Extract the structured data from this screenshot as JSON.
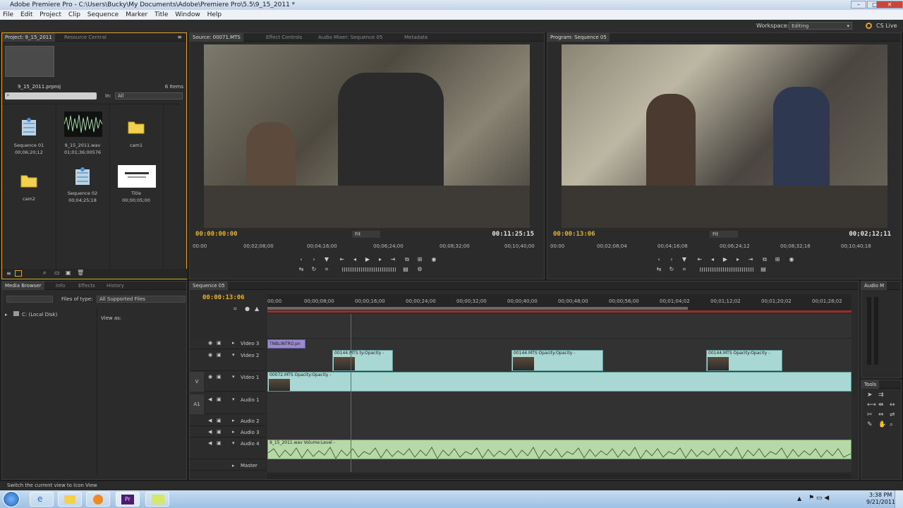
{
  "window": {
    "title": "Adobe Premiere Pro - C:\\Users\\Bucky\\My Documents\\Adobe\\Premiere Pro\\5.5\\9_15_2011 *",
    "controls": [
      "–",
      "□",
      "✕"
    ]
  },
  "menu": [
    "File",
    "Edit",
    "Project",
    "Clip",
    "Sequence",
    "Marker",
    "Title",
    "Window",
    "Help"
  ],
  "workspace": {
    "label": "Workspace:",
    "value": "Editing",
    "cs_live": "CS Live"
  },
  "project_panel": {
    "tabs": [
      "Project: 9_15_2011",
      "Resource Central"
    ],
    "file": "9_15_2011.prproj",
    "item_count": "6 Items",
    "in_label": "In:",
    "in_value": "All",
    "items": [
      {
        "name": "Sequence 01",
        "duration": "00;06;20;12",
        "type": "sequence"
      },
      {
        "name": "9_15_2011.wav",
        "duration": "01;01;36;00576",
        "type": "audio"
      },
      {
        "name": "cam1",
        "duration": "",
        "type": "folder"
      },
      {
        "name": "cam2",
        "duration": "",
        "type": "folder"
      },
      {
        "name": "Sequence 02",
        "duration": "00;04;25;18",
        "type": "sequence"
      },
      {
        "name": "Title",
        "duration": "00;00;05;00",
        "type": "title"
      }
    ]
  },
  "source_monitor": {
    "tabs": [
      "Source: 00071.MTS",
      "Effect Controls",
      "Audio Mixer: Sequence 05",
      "Metadata"
    ],
    "current_time": "00:00:00:00",
    "fit": "Fit",
    "duration": "00:11:25:15",
    "ruler": [
      "00:00",
      "00;02;08;00",
      "00;04;16;00",
      "00;06;24;00",
      "00;08;32;00",
      "00;10;40;00"
    ]
  },
  "program_monitor": {
    "tabs": [
      "Program: Sequence 05"
    ],
    "current_time": "00:00:13:06",
    "fit": "Fit",
    "duration": "00;02;12;11",
    "ruler": [
      "00:00",
      "00;02;08;04",
      "00;04;16;08",
      "00;06;24;12",
      "00;08;32;16",
      "00;10;40;18"
    ]
  },
  "media_browser": {
    "tabs": [
      "Media Browser",
      "Info",
      "Effects",
      "History"
    ],
    "files_of_type_label": "Files of type:",
    "files_of_type_value": "All Supported Files",
    "drive": "C: (Local Disk)",
    "view_as": "View as:"
  },
  "timeline": {
    "tab": "Sequence 05",
    "current_time": "00:00:13:06",
    "ruler": [
      "00;00",
      "00;00;08;00",
      "00;00;16;00",
      "00;00;24;00",
      "00;00;32;00",
      "00;00;40;00",
      "00;00;48;00",
      "00;00;56;00",
      "00;01;04;02",
      "00;01;12;02",
      "00;01;20;02",
      "00;01;28;02"
    ],
    "tracks": {
      "video3": "Video 3",
      "video2": "Video 2",
      "video1": "Video 1",
      "audio1": "Audio 1",
      "audio2": "Audio 2",
      "audio3": "Audio 3",
      "audio4": "Audio 4",
      "master": "Master"
    },
    "clips": {
      "title_clip": "TNBLINTRO.pn",
      "v2_clip_a": "00144.MTS  ty:Opacity -",
      "v2_clip_b": "00144.MTS   Opacity:Opacity -",
      "v2_clip_c": "00144.MTS   Opacity:Opacity -",
      "v1_clip": "00072.MTS  Opacity:Opacity -",
      "a4_clip": "9_15_2011.wav  Volume:Level -"
    },
    "v_label": "V",
    "a_label": "A1"
  },
  "audio_meter": {
    "tab": "Audio M"
  },
  "tools": {
    "tab": "Tools"
  },
  "status": "Switch the current view to Icon View",
  "taskbar": {
    "time": "3:38 PM",
    "date": "9/21/2011"
  }
}
